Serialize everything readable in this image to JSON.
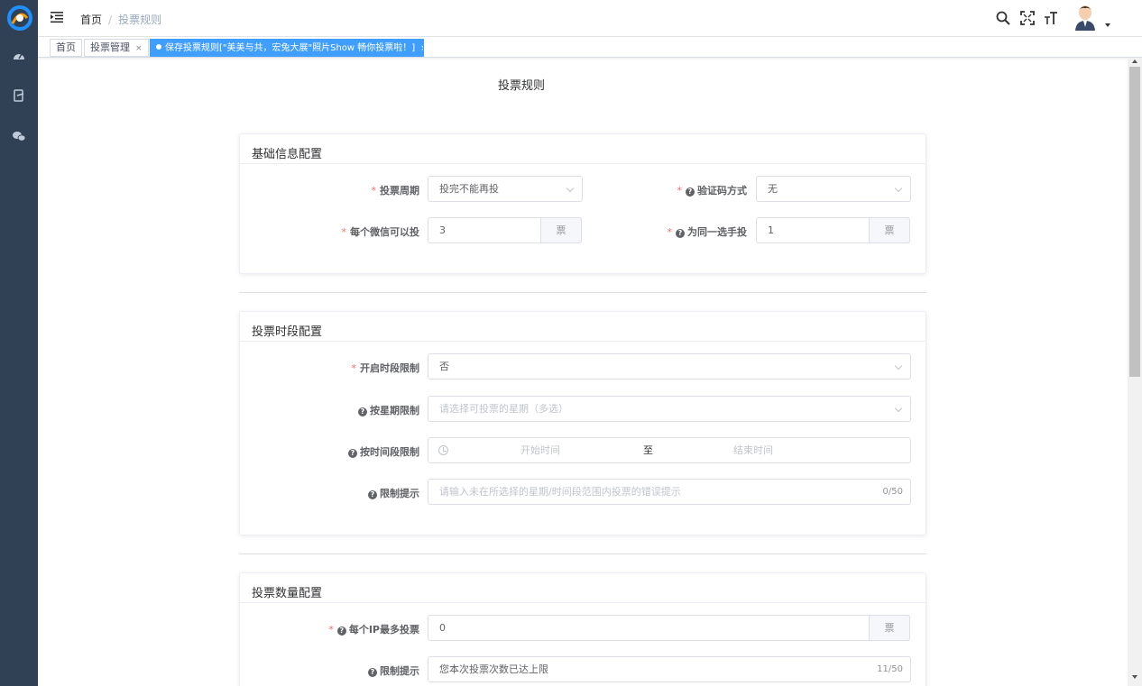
{
  "header": {
    "breadcrumb_home": "首页",
    "breadcrumb_sep": "/",
    "breadcrumb_current": "投票规则"
  },
  "tags": [
    {
      "label": "首页"
    },
    {
      "label": "投票管理",
      "close": "×"
    },
    {
      "label": "保存投票规则[\"美美与共，宏兔大展\"照片Show 畅你投票啦！]",
      "close": "×",
      "active": true
    }
  ],
  "page_title": "投票规则",
  "basic": {
    "title": "基础信息配置",
    "cycle_label": "投票周期",
    "cycle_value": "投完不能再投",
    "captcha_label": "验证码方式",
    "captcha_value": "无",
    "per_wechat_label": "每个微信可以投",
    "per_wechat_value": "3",
    "per_wechat_unit": "票",
    "same_player_label": "为同一选手投",
    "same_player_value": "1",
    "same_player_unit": "票"
  },
  "time": {
    "title": "投票时段配置",
    "enable_label": "开启时段限制",
    "enable_value": "否",
    "weekday_label": "按星期限制",
    "weekday_placeholder": "请选择可投票的星期（多选）",
    "timerange_label": "按时间段限制",
    "start_placeholder": "开始时间",
    "range_sep": "至",
    "end_placeholder": "结束时间",
    "tip_label": "限制提示",
    "tip_placeholder": "请输入未在所选择的星期/时间段范围内投票的错误提示",
    "tip_counter": "0/50"
  },
  "count": {
    "title": "投票数量配置",
    "per_ip_label": "每个IP最多投票",
    "per_ip_value": "0",
    "per_ip_unit": "票",
    "tip_label": "限制提示",
    "tip_value": "您本次投票次数已达上限",
    "tip_counter": "11/50"
  },
  "required_mark": "*",
  "help_mark": "?",
  "colors": {
    "sidebar": "#304156",
    "accent": "#409eff",
    "required": "#f56c6c"
  }
}
